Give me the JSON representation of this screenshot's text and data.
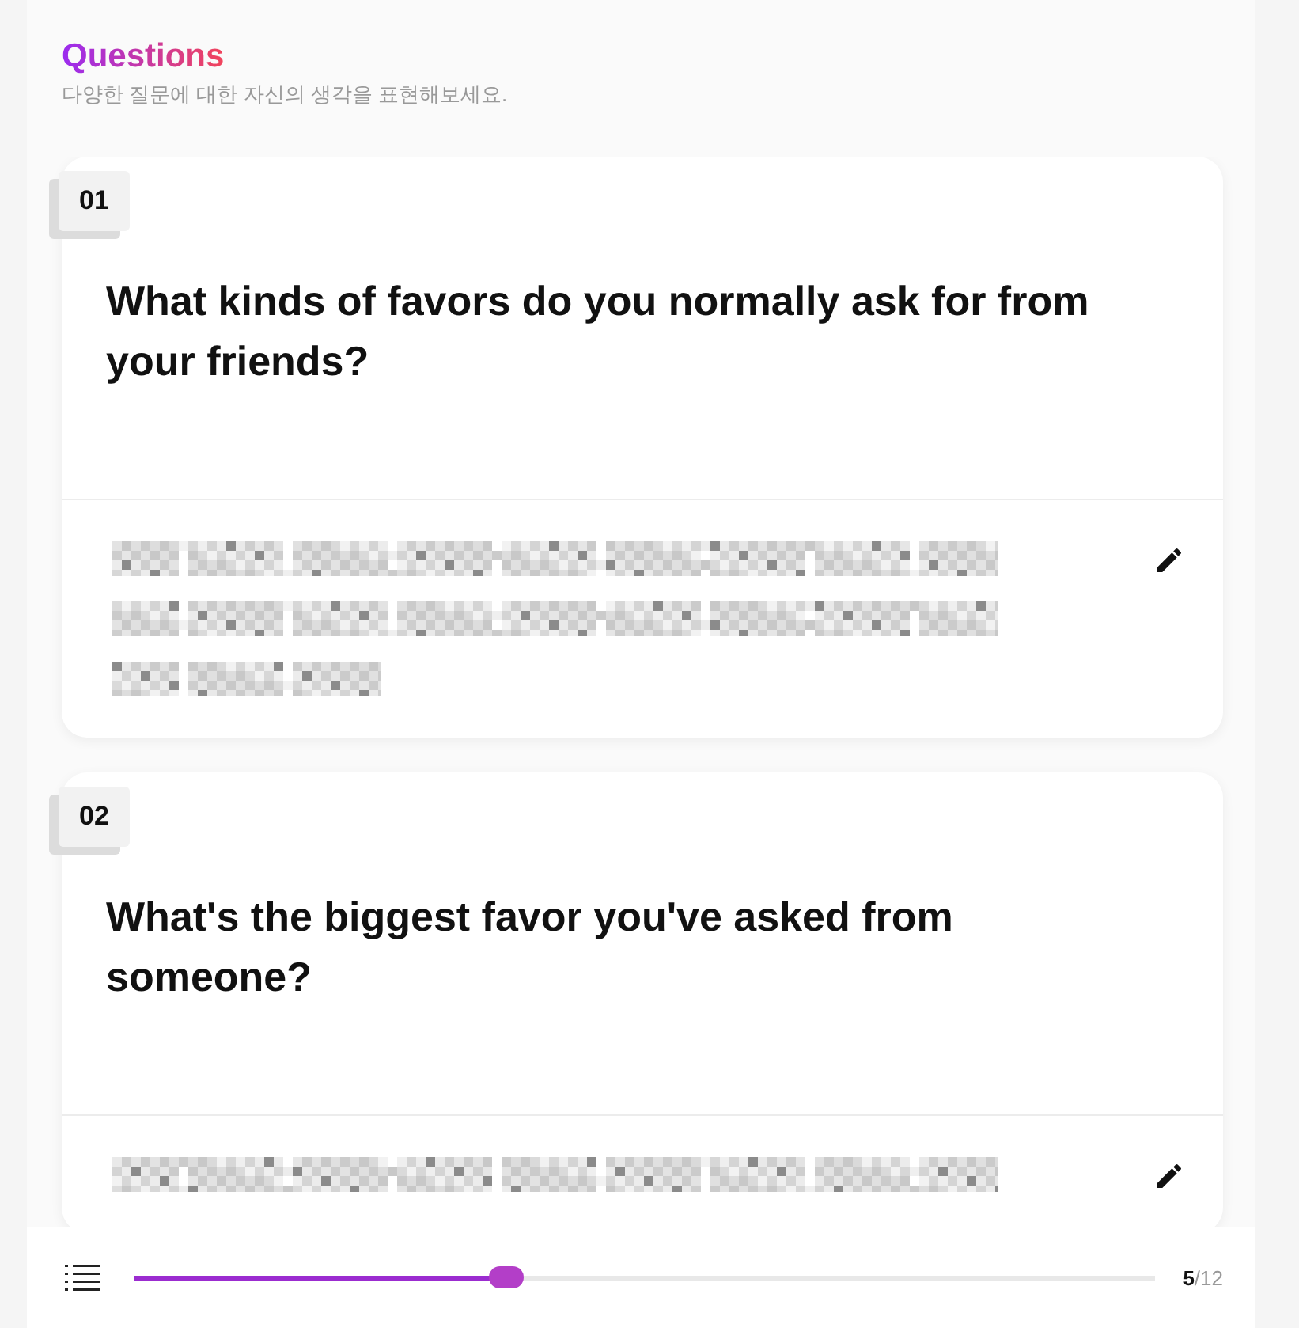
{
  "header": {
    "title": "Questions",
    "subtitle": "다양한 질문에 대한 자신의 생각을 표현해보세요."
  },
  "questions": [
    {
      "number": "01",
      "text": "What kinds of favors do you normally ask for from your friends?",
      "answer": {
        "redacted": true,
        "lines": [
          {
            "kind": "long"
          },
          {
            "kind": "long"
          },
          {
            "kind": "short"
          }
        ]
      }
    },
    {
      "number": "02",
      "text": "What's the biggest favor you've asked from someone?",
      "answer": {
        "redacted": true,
        "lines": [
          {
            "kind": "long"
          }
        ]
      }
    }
  ],
  "progress": {
    "level": 0.364,
    "current": "5",
    "total": "/12"
  }
}
